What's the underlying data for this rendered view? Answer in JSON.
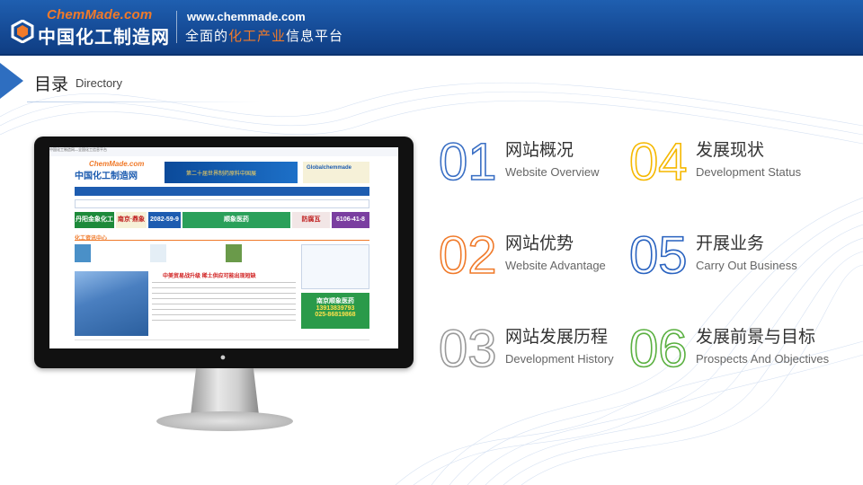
{
  "header": {
    "logo_en": "ChemMade.com",
    "logo_cn": "中国化工制造网",
    "site_url": "www.chemmade.com",
    "slogan_prefix": "全面的",
    "slogan_highlight": "化工产业",
    "slogan_suffix": "信息平台"
  },
  "title": {
    "cn": "目录",
    "en": "Directory"
  },
  "monitor_screen": {
    "top_strip": "中国化工制造网—全国化工信息平台",
    "logo_en": "ChemMade.com",
    "logo_cn": "中国化工制造网",
    "banner1": "第二十届世界制药原料中国展",
    "banner2": "Globalchemmade",
    "ad1": "丹阳金象化工厂",
    "ad2": "南京·鼎象",
    "ad3": "2082-59-9",
    "ad4": "顺象医药",
    "ad5": "防腐瓦",
    "ad6": "6106-41-8",
    "section_title": "化工资讯中心",
    "headline": "中美贸易战升级  稀土供应可能出现短缺",
    "side_ad_name": "南京顺象医药",
    "side_ad_phone1": "13913839793",
    "side_ad_phone2": "025-86819868"
  },
  "directory": [
    {
      "num": "01",
      "cn": "网站概况",
      "en": "Website Overview",
      "color": "#3a6fc4"
    },
    {
      "num": "02",
      "cn": "网站优势",
      "en": "Website Advantage",
      "color": "#f07a2a"
    },
    {
      "num": "03",
      "cn": "网站发展历程",
      "en": "Development History",
      "color": "#9a9a9a"
    },
    {
      "num": "04",
      "cn": "发展现状",
      "en": "Development Status",
      "color": "#f5b800"
    },
    {
      "num": "05",
      "cn": "开展业务",
      "en": "Carry Out Business",
      "color": "#2a63c0"
    },
    {
      "num": "06",
      "cn": "发展前景与目标",
      "en": "Prospects And Objectives",
      "color": "#5ab040"
    }
  ],
  "colors": {
    "header_blue": "#1a55a5",
    "accent_orange": "#f07a2a"
  }
}
